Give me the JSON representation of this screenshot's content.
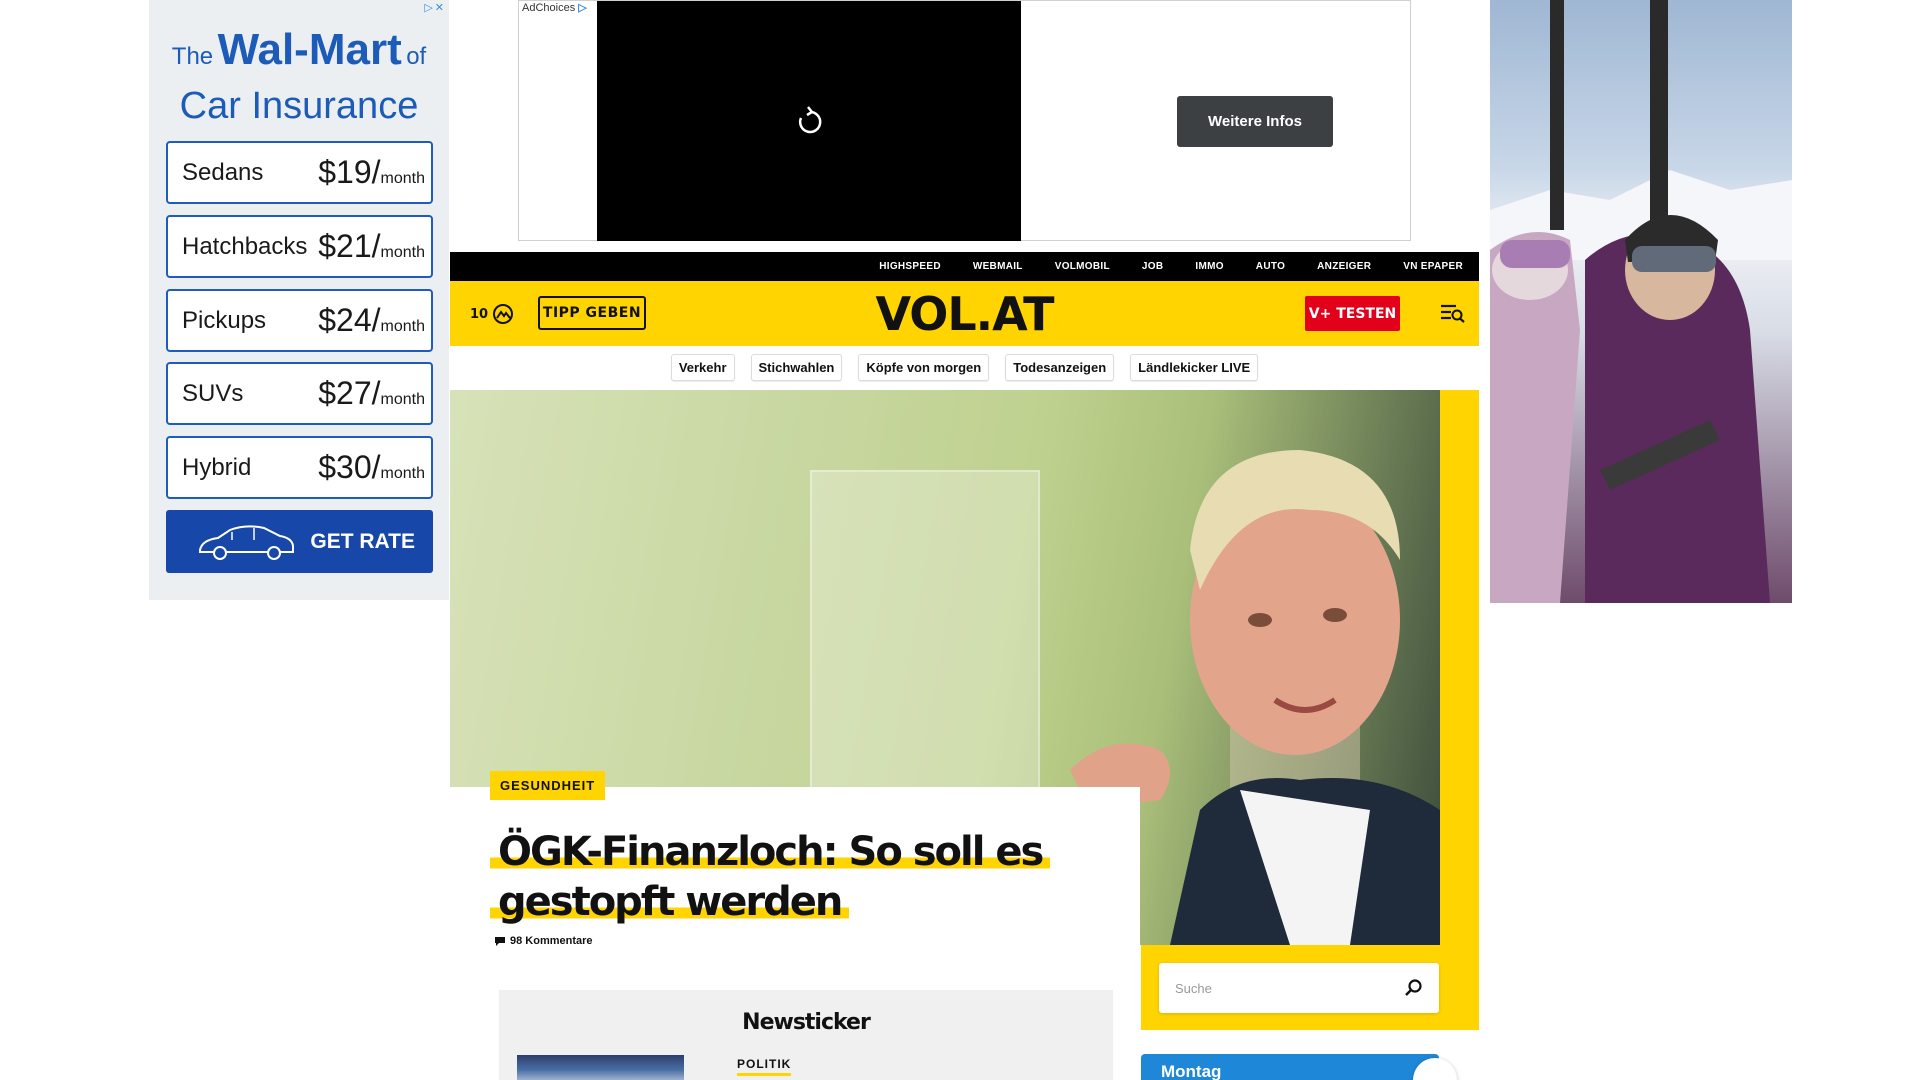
{
  "left_ad": {
    "adchoices_icon": "adchoices-close-icons",
    "headline_the": "The",
    "headline_brand": "Wal-Mart",
    "headline_of": "of",
    "headline_line2": "Car Insurance",
    "rates": [
      {
        "car": "Sedans",
        "price": "$19/",
        "per": "month"
      },
      {
        "car": "Hatchbacks",
        "price": "$21/",
        "per": "month"
      },
      {
        "car": "Pickups",
        "price": "$24/",
        "per": "month"
      },
      {
        "car": "SUVs",
        "price": "$27/",
        "per": "month"
      },
      {
        "car": "Hybrid",
        "price": "$30/",
        "per": "month"
      }
    ],
    "cta": "GET RATE"
  },
  "top_ad": {
    "adchoices_label": "AdChoices",
    "more_info": "Weitere Infos"
  },
  "top_nav": [
    "HIGHSPEED",
    "WEBMAIL",
    "VOLMOBIL",
    "JOB",
    "IMMO",
    "AUTO",
    "ANZEIGER",
    "VN EPAPER"
  ],
  "header": {
    "temperature": "10",
    "tipp": "TIPP GEBEN",
    "logo": "VOL.AT",
    "vplus": "V+ TESTEN"
  },
  "chips": [
    "Verkehr",
    "Stichwahlen",
    "Köpfe von morgen",
    "Todesanzeigen",
    "Ländlekicker LIVE"
  ],
  "hero": {
    "category": "GESUNDHEIT",
    "title": "ÖGK-Finanzloch: So soll es gestopft werden",
    "comments": "98 Kommentare"
  },
  "search": {
    "placeholder": "Suche"
  },
  "ticker": {
    "title": "Newsticker",
    "first_tag": "POLITIK"
  },
  "day_card": {
    "label": "Montag"
  },
  "colors": {
    "brand_yellow": "#ffd400",
    "brand_red": "#e3001b",
    "ad_blue": "#1747a8",
    "ticker_blue": "#1f87d8"
  }
}
